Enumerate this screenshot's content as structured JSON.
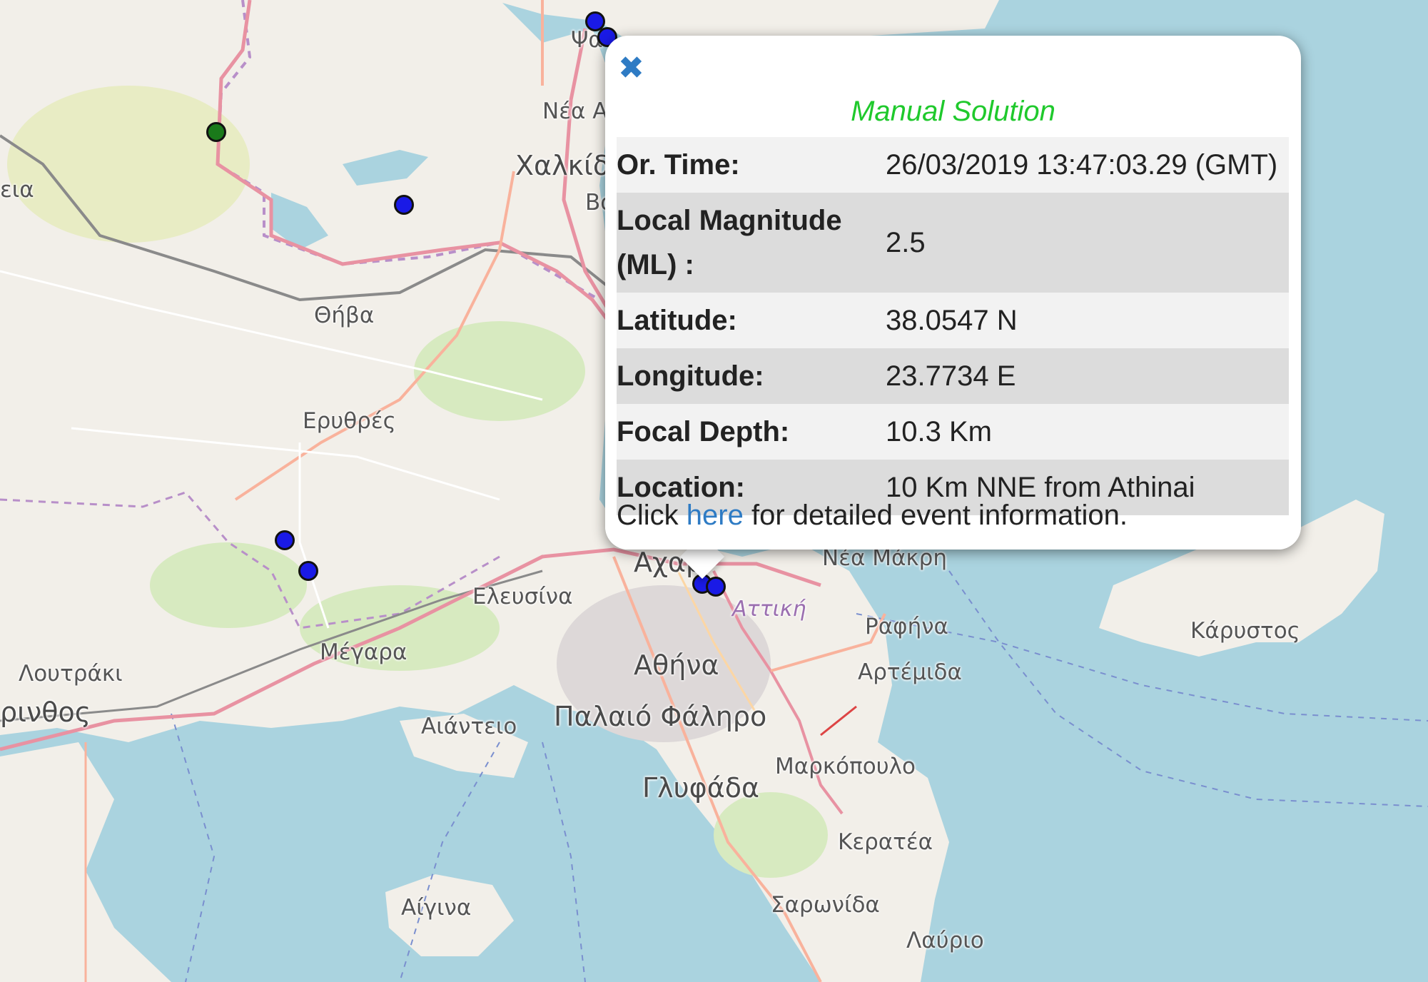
{
  "map": {
    "places": {
      "fa": "Ψα",
      "nea_a": "Νέα Α",
      "chalkida": "Χαλκίδ",
      "vo": "Βο",
      "eia": "εια",
      "thiva": "Θήβα",
      "erythres": "Ερυθρές",
      "elefsina": "Ελευσίνα",
      "acharnes": "Αχαρ",
      "nea_makri": "Νέα Μάκρη",
      "attiki": "Αττική",
      "rafina": "Ραφήνα",
      "karystos": "Κάρυστος",
      "megara": "Μέγαρα",
      "loutraki": "Λουτράκι",
      "korinthos": "ρινθος",
      "athina": "Αθήνα",
      "artemida": "Αρτέμιδα",
      "aianteio": "Αιάντειο",
      "palaio_faliro": "Παλαιό Φάληρο",
      "markopoulo": "Μαρκόπουλο",
      "glyfada": "Γλυφάδα",
      "keratea": "Κερατέα",
      "aigina": "Αίγινα",
      "saronida": "Σαρωνίδα",
      "lavrio": "Λαύριο"
    },
    "colors": {
      "sea": "#aad3df",
      "land": "#f2efe9",
      "motorway": "#e892a2",
      "trunk": "#f9b29c",
      "boundary": "#b88fc9",
      "rail": "#8a8a8a"
    },
    "markers": [
      {
        "color": "#1a1ae6"
      },
      {
        "color": "#1a1ae6"
      },
      {
        "color": "#1a7a1a"
      },
      {
        "color": "#1a1ae6"
      },
      {
        "color": "#1a1ae6"
      },
      {
        "color": "#1a1ae6"
      },
      {
        "color": "#1a1ae6"
      },
      {
        "color": "#1a1ae6"
      }
    ]
  },
  "popup": {
    "close_icon": "close-icon",
    "title": "Manual Solution",
    "rows": [
      {
        "label": "Or. Time:",
        "value": "26/03/2019 13:47:03.29 (GMT)"
      },
      {
        "label": "Local Magnitude (ML) :",
        "value": "2.5"
      },
      {
        "label": "Latitude:",
        "value": "38.0547 N"
      },
      {
        "label": "Longitude:",
        "value": "23.7734 E"
      },
      {
        "label": "Focal Depth:",
        "value": "10.3 Km"
      },
      {
        "label": "Location:",
        "value": "10 Km NNE from Athinai"
      }
    ],
    "detail_prefix": "Click",
    "detail_link": "here",
    "detail_suffix": "for detailed event information."
  }
}
